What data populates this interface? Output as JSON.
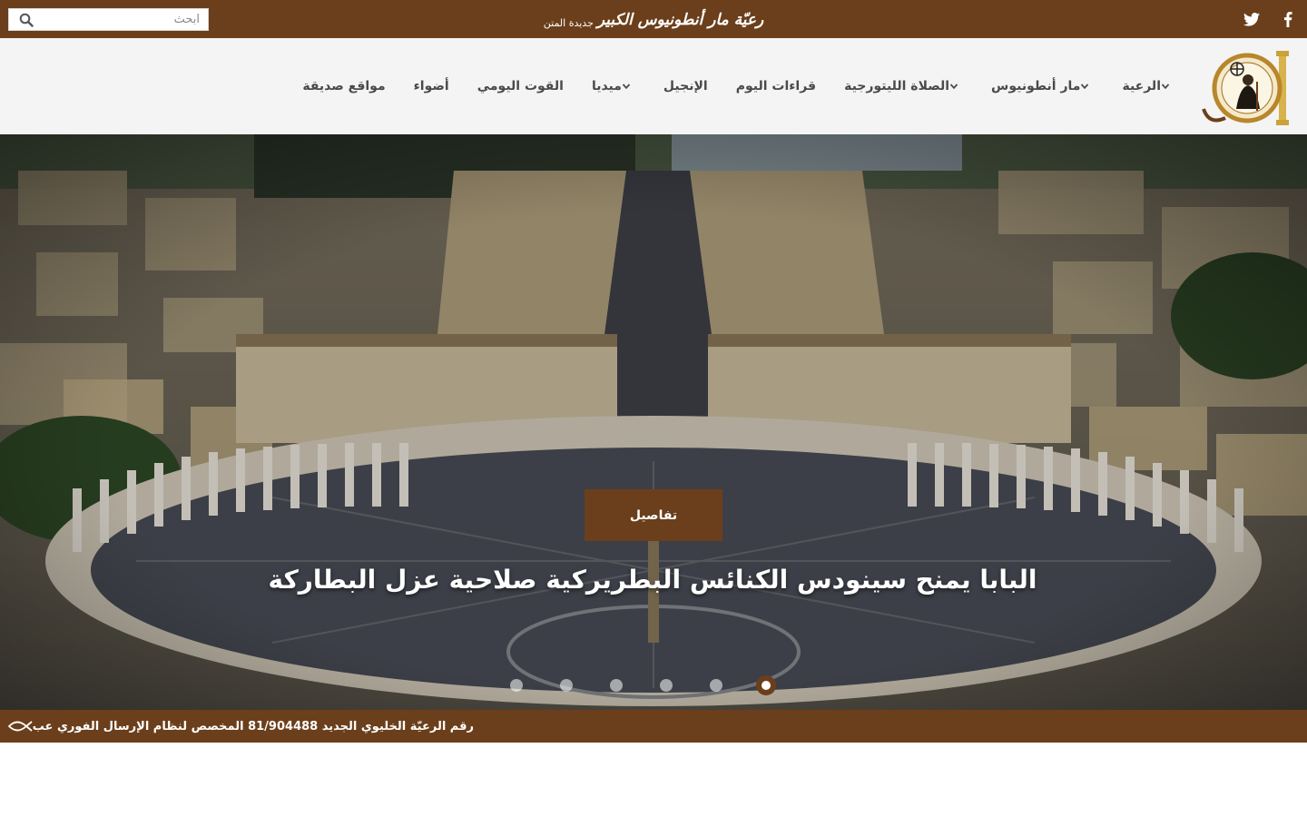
{
  "search": {
    "placeholder": "ابحث"
  },
  "header": {
    "brand_title": "رعيّة مار أنطونيوس الكبير",
    "brand_subtitle": "جديدة المتن"
  },
  "social": {
    "facebook": "facebook-icon",
    "twitter": "twitter-icon"
  },
  "nav": {
    "items": [
      {
        "label": "الرعية",
        "has_dropdown": true
      },
      {
        "label": "مار أنطونيوس",
        "has_dropdown": true
      },
      {
        "label": "الصلاة الليتورجية",
        "has_dropdown": true
      },
      {
        "label": "قراءات اليوم",
        "has_dropdown": false
      },
      {
        "label": "الإنجيل",
        "has_dropdown": false
      },
      {
        "label": "ميديا",
        "has_dropdown": true
      },
      {
        "label": "القوت اليومي",
        "has_dropdown": false
      },
      {
        "label": "أضواء",
        "has_dropdown": false
      },
      {
        "label": "مواقع صديقة",
        "has_dropdown": false
      }
    ]
  },
  "hero": {
    "title": "البابا يمنح سينودس الكنائس البطريركية صلاحية عزل البطاركة",
    "button_label": "تفاصيل",
    "slide_count": 6,
    "active_slide": 1
  },
  "ticker": {
    "text": "رقم الرعيّة الخليوي الجديد 81/904488 المخصص لنظام الإرسال الفوري عب"
  },
  "colors": {
    "brand": "#6b3f1b",
    "nav_bg": "#f4f4f4",
    "menu_text": "#4a4a4a"
  }
}
